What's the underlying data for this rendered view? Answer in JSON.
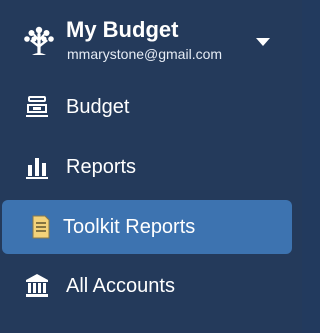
{
  "header": {
    "budget_name": "My Budget",
    "email": "mmarystone@gmail.com",
    "logo_icon": "tree-icon",
    "caret_icon": "caret-down-icon"
  },
  "nav": {
    "items": [
      {
        "label": "Budget",
        "icon": "budget-icon",
        "active": false
      },
      {
        "label": "Reports",
        "icon": "bar-chart-icon",
        "active": false
      },
      {
        "label": "Toolkit Reports",
        "icon": "document-icon",
        "active": true
      },
      {
        "label": "All Accounts",
        "icon": "bank-icon",
        "active": false
      }
    ]
  },
  "colors": {
    "sidebar_bg": "#243a5b",
    "active_bg": "#3d73b0",
    "document_icon": "#f3d27a",
    "text": "#ffffff"
  }
}
